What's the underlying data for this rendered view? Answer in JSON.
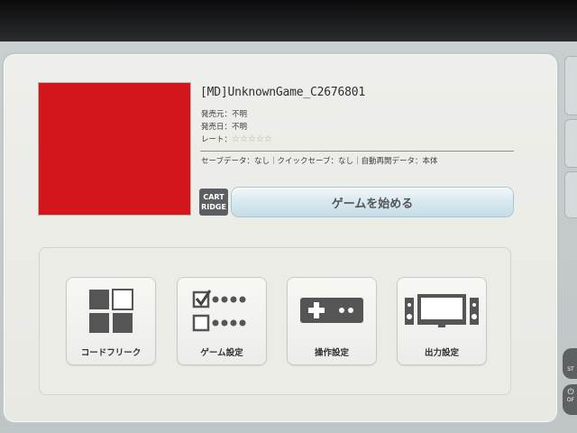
{
  "game": {
    "title": "[MD]UnknownGame_C2676801",
    "publisher": "発売元：不明",
    "release_date": "発売日：不明",
    "rating_label": "レート：",
    "rating_stars": "☆☆☆☆☆",
    "save_info": "セーブデータ：なし｜クイックセーブ：なし｜自動再開データ：本体",
    "cover_color": "#d3151c"
  },
  "media_icon": {
    "line1": "CART",
    "line2": "RIDGE"
  },
  "start_button": {
    "label": "ゲームを始める"
  },
  "menu": [
    {
      "label": "コードフリーク",
      "icon": "code-freak-icon"
    },
    {
      "label": "ゲーム設定",
      "icon": "game-settings-icon"
    },
    {
      "label": "操作設定",
      "icon": "controller-icon"
    },
    {
      "label": "出力設定",
      "icon": "display-output-icon"
    }
  ],
  "side_tabs": {
    "top_text": "ST",
    "bottom_text": "OF"
  }
}
